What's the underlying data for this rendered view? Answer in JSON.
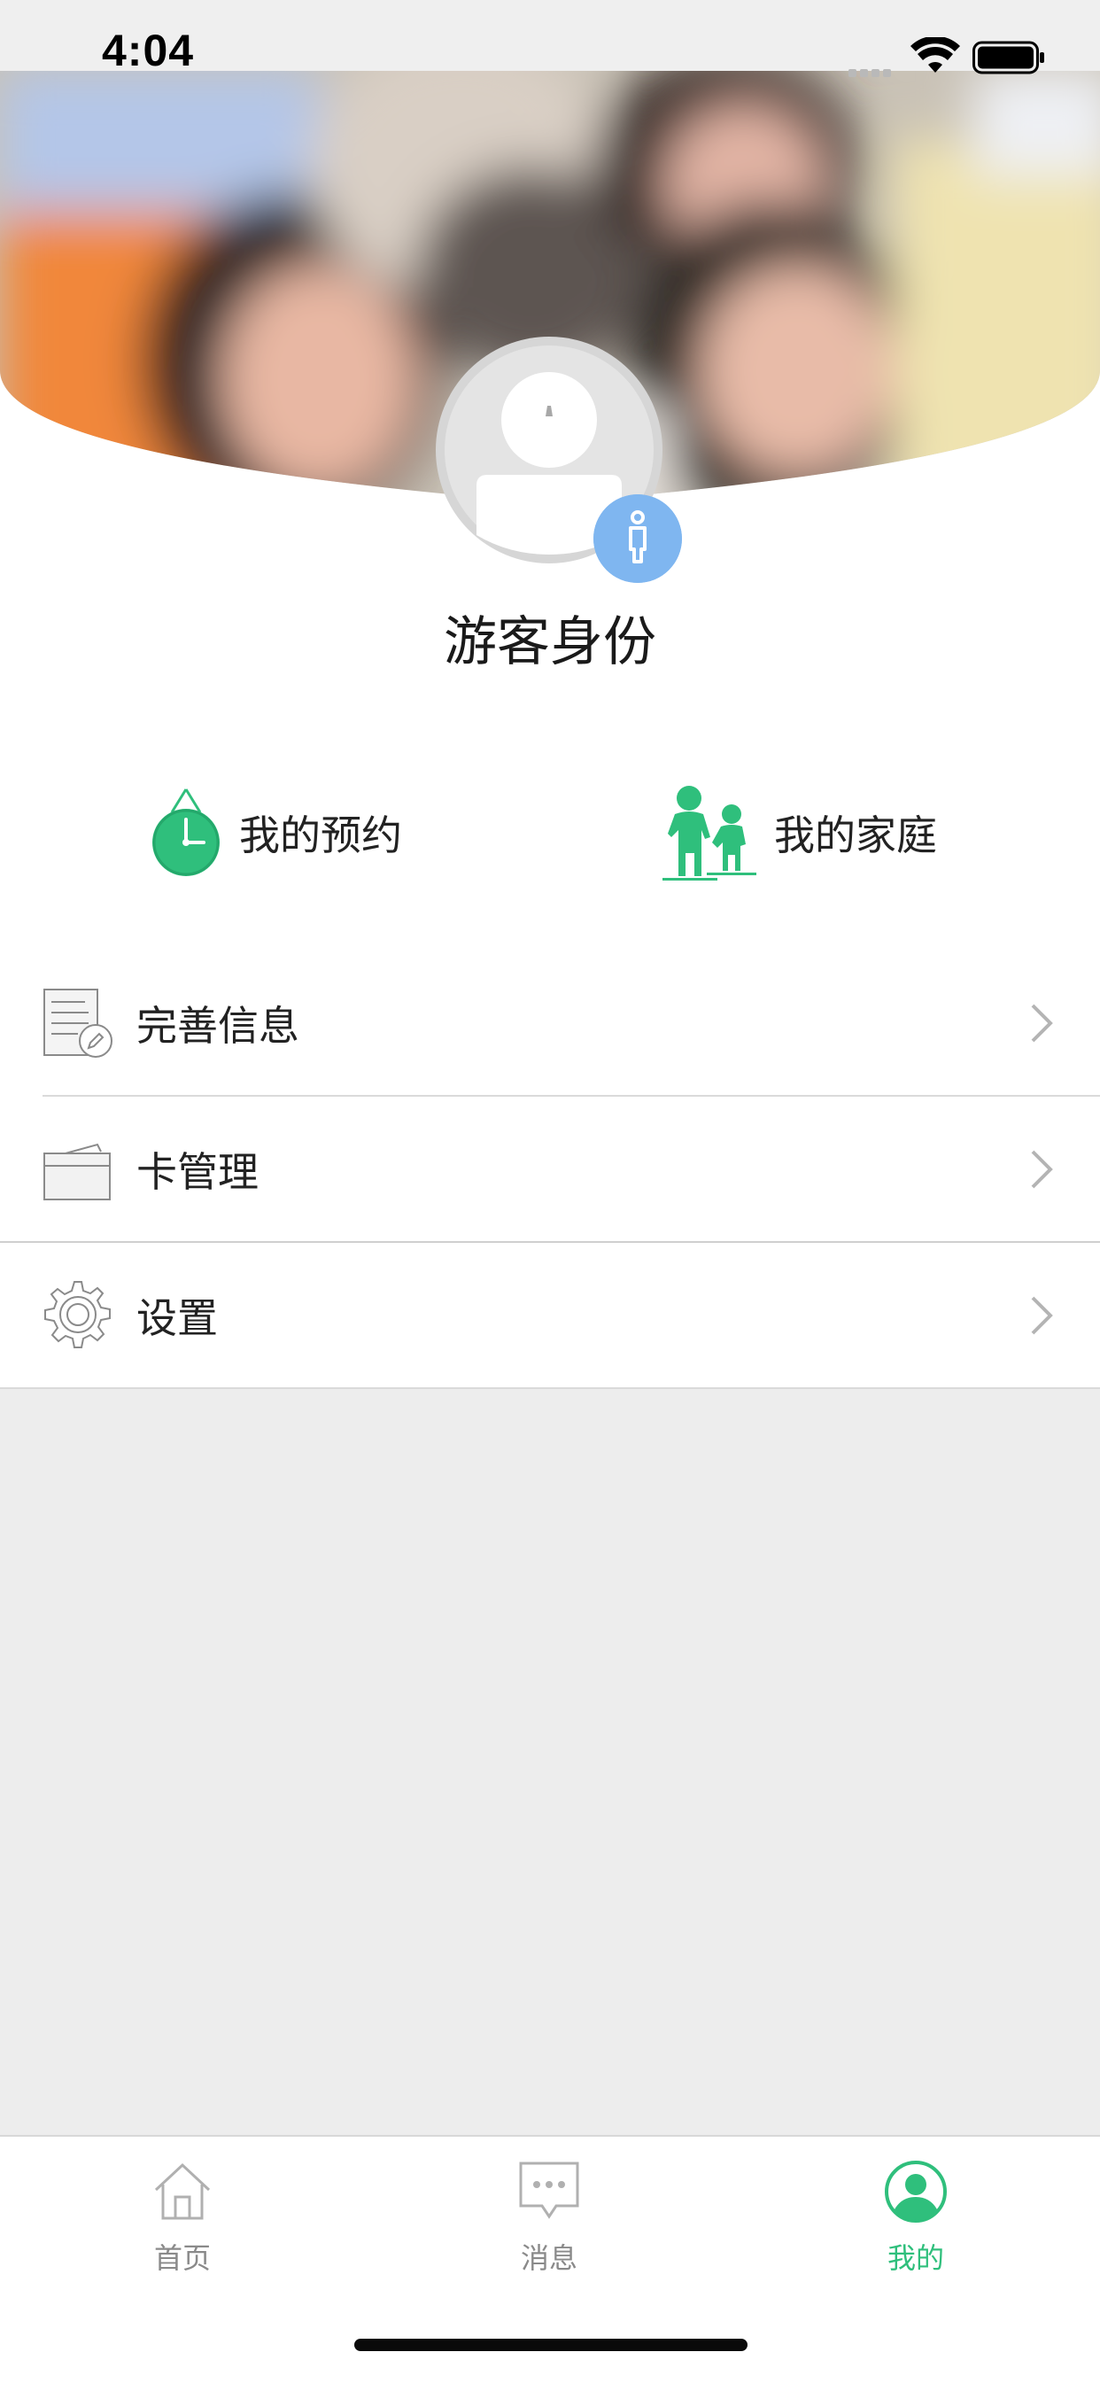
{
  "status": {
    "time": "4:04"
  },
  "profile": {
    "name": "游客身份"
  },
  "shortcuts": [
    {
      "label": "我的预约",
      "icon": "clock-icon"
    },
    {
      "label": "我的家庭",
      "icon": "family-icon"
    }
  ],
  "menu": [
    {
      "label": "完善信息",
      "icon": "document-edit-icon"
    },
    {
      "label": "卡管理",
      "icon": "card-icon"
    },
    {
      "label": "设置",
      "icon": "gear-icon"
    }
  ],
  "tabs": [
    {
      "label": "首页",
      "icon": "home-icon",
      "active": false
    },
    {
      "label": "消息",
      "icon": "message-icon",
      "active": false
    },
    {
      "label": "我的",
      "icon": "user-icon",
      "active": true
    }
  ],
  "colors": {
    "accent": "#2fbf7c",
    "badge": "#7fb6f0",
    "background": "#ededed"
  }
}
